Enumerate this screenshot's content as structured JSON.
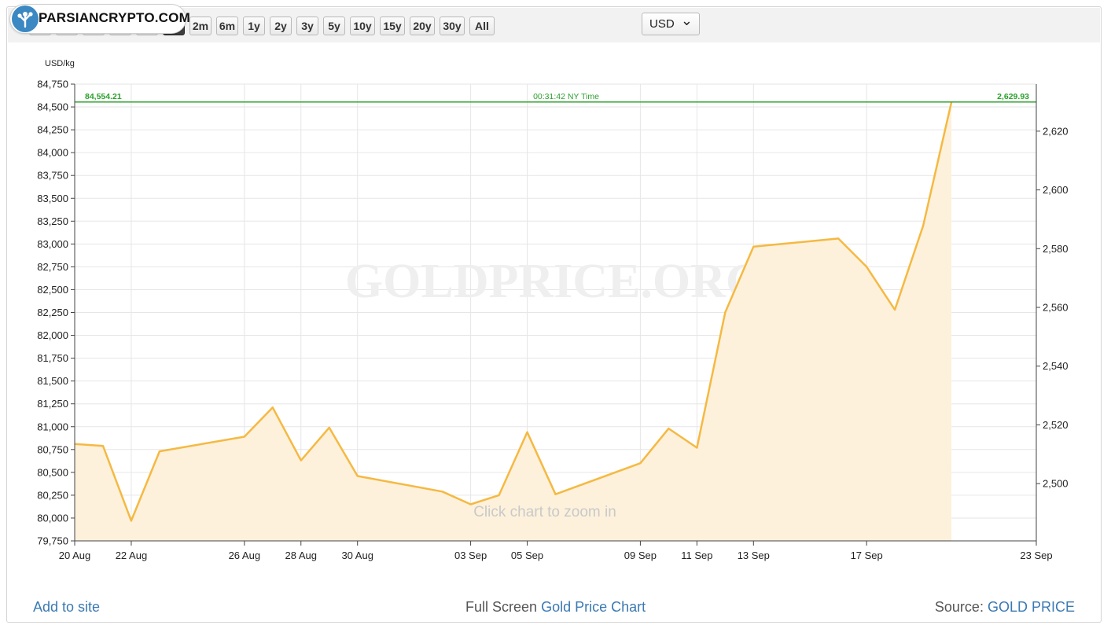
{
  "toolbar": {
    "range_buttons": [
      "1h",
      "1d",
      "3d",
      "5d",
      "1w",
      "1m",
      "2m",
      "6m",
      "1y",
      "2y",
      "3y",
      "5y",
      "10y",
      "15y",
      "20y",
      "30y",
      "All"
    ],
    "active_range": "1m",
    "currency": "USD"
  },
  "watermark_logo": {
    "text": "PARSIANCRYPTO.COM",
    "icon": "tree-network-icon"
  },
  "chart_watermark": "GOLDPRICE.ORG",
  "zoom_hint": "Click chart to zoom in",
  "current_price_line": {
    "left_label": "84,554.21",
    "center_label": "00:31:42 NY Time",
    "right_label": "2,629.93",
    "color": "#2ca02c"
  },
  "footer": {
    "add_to_site": "Add to site",
    "full_screen_prefix": "Full Screen",
    "full_screen_link": "Gold Price Chart",
    "source_prefix": "Source:",
    "source_link": "GOLD PRICE"
  },
  "colors": {
    "line": "#f5b942",
    "fill": "#fdf1dc",
    "grid": "#e6e6e6",
    "accent_green": "#2ca02c",
    "link": "#3b79b2"
  },
  "chart_data": {
    "type": "area",
    "ylabel": "USD/kg",
    "y_ticks": [
      "79,750",
      "80,000",
      "80,250",
      "80,500",
      "80,750",
      "81,000",
      "81,250",
      "81,500",
      "81,750",
      "82,000",
      "82,250",
      "82,500",
      "82,750",
      "83,000",
      "83,250",
      "83,500",
      "83,750",
      "84,000",
      "84,250",
      "84,500",
      "84,750"
    ],
    "ylim": [
      79750,
      84750
    ],
    "y2_ticks": [
      "2,500",
      "2,520",
      "2,540",
      "2,560",
      "2,580",
      "2,600",
      "2,620"
    ],
    "y2_units": "USD/oz",
    "x_ticks": [
      "20 Aug",
      "22 Aug",
      "26 Aug",
      "28 Aug",
      "30 Aug",
      "03 Sep",
      "05 Sep",
      "09 Sep",
      "11 Sep",
      "13 Sep",
      "17 Sep",
      "23 Sep"
    ],
    "x": [
      "20 Aug",
      "21 Aug",
      "22 Aug",
      "23 Aug",
      "26 Aug",
      "27 Aug",
      "28 Aug",
      "29 Aug",
      "30 Aug",
      "02 Sep",
      "03 Sep",
      "04 Sep",
      "05 Sep",
      "06 Sep",
      "09 Sep",
      "10 Sep",
      "11 Sep",
      "12 Sep",
      "13 Sep",
      "16 Sep",
      "17 Sep",
      "18 Sep",
      "19 Sep",
      "20 Sep",
      "23 Sep"
    ],
    "series": [
      {
        "values": [
          80810,
          80790,
          79970,
          80730,
          80890,
          81210,
          80630,
          80990,
          80460,
          80290,
          80150,
          80250,
          80940,
          80260,
          80600,
          80980,
          80770,
          82250,
          82970,
          83060,
          82750,
          82280,
          83200,
          84554.21
        ]
      }
    ],
    "grid": true,
    "legend": "none"
  }
}
